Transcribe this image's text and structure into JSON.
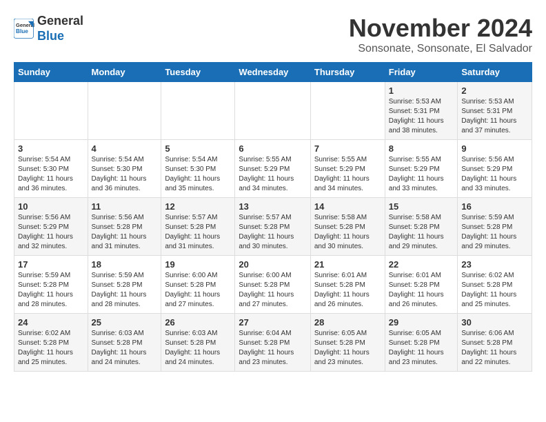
{
  "logo": {
    "line1": "General",
    "line2": "Blue"
  },
  "title": "November 2024",
  "location": "Sonsonate, Sonsonate, El Salvador",
  "weekdays": [
    "Sunday",
    "Monday",
    "Tuesday",
    "Wednesday",
    "Thursday",
    "Friday",
    "Saturday"
  ],
  "weeks": [
    [
      {
        "num": "",
        "info": ""
      },
      {
        "num": "",
        "info": ""
      },
      {
        "num": "",
        "info": ""
      },
      {
        "num": "",
        "info": ""
      },
      {
        "num": "",
        "info": ""
      },
      {
        "num": "1",
        "info": "Sunrise: 5:53 AM\nSunset: 5:31 PM\nDaylight: 11 hours and 38 minutes."
      },
      {
        "num": "2",
        "info": "Sunrise: 5:53 AM\nSunset: 5:31 PM\nDaylight: 11 hours and 37 minutes."
      }
    ],
    [
      {
        "num": "3",
        "info": "Sunrise: 5:54 AM\nSunset: 5:30 PM\nDaylight: 11 hours and 36 minutes."
      },
      {
        "num": "4",
        "info": "Sunrise: 5:54 AM\nSunset: 5:30 PM\nDaylight: 11 hours and 36 minutes."
      },
      {
        "num": "5",
        "info": "Sunrise: 5:54 AM\nSunset: 5:30 PM\nDaylight: 11 hours and 35 minutes."
      },
      {
        "num": "6",
        "info": "Sunrise: 5:55 AM\nSunset: 5:29 PM\nDaylight: 11 hours and 34 minutes."
      },
      {
        "num": "7",
        "info": "Sunrise: 5:55 AM\nSunset: 5:29 PM\nDaylight: 11 hours and 34 minutes."
      },
      {
        "num": "8",
        "info": "Sunrise: 5:55 AM\nSunset: 5:29 PM\nDaylight: 11 hours and 33 minutes."
      },
      {
        "num": "9",
        "info": "Sunrise: 5:56 AM\nSunset: 5:29 PM\nDaylight: 11 hours and 33 minutes."
      }
    ],
    [
      {
        "num": "10",
        "info": "Sunrise: 5:56 AM\nSunset: 5:29 PM\nDaylight: 11 hours and 32 minutes."
      },
      {
        "num": "11",
        "info": "Sunrise: 5:56 AM\nSunset: 5:28 PM\nDaylight: 11 hours and 31 minutes."
      },
      {
        "num": "12",
        "info": "Sunrise: 5:57 AM\nSunset: 5:28 PM\nDaylight: 11 hours and 31 minutes."
      },
      {
        "num": "13",
        "info": "Sunrise: 5:57 AM\nSunset: 5:28 PM\nDaylight: 11 hours and 30 minutes."
      },
      {
        "num": "14",
        "info": "Sunrise: 5:58 AM\nSunset: 5:28 PM\nDaylight: 11 hours and 30 minutes."
      },
      {
        "num": "15",
        "info": "Sunrise: 5:58 AM\nSunset: 5:28 PM\nDaylight: 11 hours and 29 minutes."
      },
      {
        "num": "16",
        "info": "Sunrise: 5:59 AM\nSunset: 5:28 PM\nDaylight: 11 hours and 29 minutes."
      }
    ],
    [
      {
        "num": "17",
        "info": "Sunrise: 5:59 AM\nSunset: 5:28 PM\nDaylight: 11 hours and 28 minutes."
      },
      {
        "num": "18",
        "info": "Sunrise: 5:59 AM\nSunset: 5:28 PM\nDaylight: 11 hours and 28 minutes."
      },
      {
        "num": "19",
        "info": "Sunrise: 6:00 AM\nSunset: 5:28 PM\nDaylight: 11 hours and 27 minutes."
      },
      {
        "num": "20",
        "info": "Sunrise: 6:00 AM\nSunset: 5:28 PM\nDaylight: 11 hours and 27 minutes."
      },
      {
        "num": "21",
        "info": "Sunrise: 6:01 AM\nSunset: 5:28 PM\nDaylight: 11 hours and 26 minutes."
      },
      {
        "num": "22",
        "info": "Sunrise: 6:01 AM\nSunset: 5:28 PM\nDaylight: 11 hours and 26 minutes."
      },
      {
        "num": "23",
        "info": "Sunrise: 6:02 AM\nSunset: 5:28 PM\nDaylight: 11 hours and 25 minutes."
      }
    ],
    [
      {
        "num": "24",
        "info": "Sunrise: 6:02 AM\nSunset: 5:28 PM\nDaylight: 11 hours and 25 minutes."
      },
      {
        "num": "25",
        "info": "Sunrise: 6:03 AM\nSunset: 5:28 PM\nDaylight: 11 hours and 24 minutes."
      },
      {
        "num": "26",
        "info": "Sunrise: 6:03 AM\nSunset: 5:28 PM\nDaylight: 11 hours and 24 minutes."
      },
      {
        "num": "27",
        "info": "Sunrise: 6:04 AM\nSunset: 5:28 PM\nDaylight: 11 hours and 23 minutes."
      },
      {
        "num": "28",
        "info": "Sunrise: 6:05 AM\nSunset: 5:28 PM\nDaylight: 11 hours and 23 minutes."
      },
      {
        "num": "29",
        "info": "Sunrise: 6:05 AM\nSunset: 5:28 PM\nDaylight: 11 hours and 23 minutes."
      },
      {
        "num": "30",
        "info": "Sunrise: 6:06 AM\nSunset: 5:28 PM\nDaylight: 11 hours and 22 minutes."
      }
    ]
  ]
}
